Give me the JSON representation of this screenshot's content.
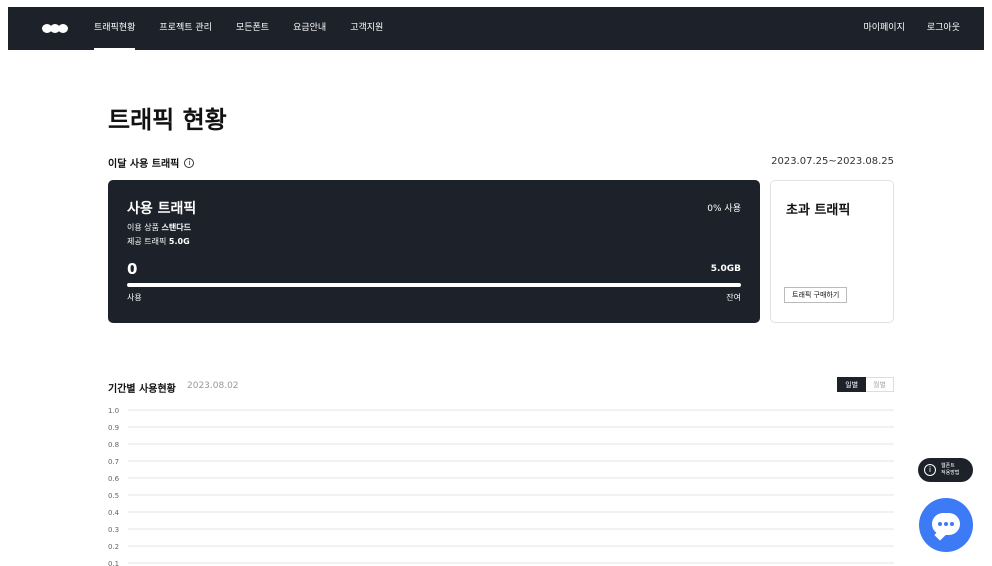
{
  "nav": {
    "items": [
      {
        "label": "트래픽현황",
        "active": true
      },
      {
        "label": "프로젝트 관리",
        "active": false
      },
      {
        "label": "모든폰트",
        "active": false
      },
      {
        "label": "요금안내",
        "active": false
      },
      {
        "label": "고객지원",
        "active": false
      }
    ],
    "mypage_label": "마이페이지",
    "logout_label": "로그아웃"
  },
  "page": {
    "title": "트래픽 현황"
  },
  "monthly": {
    "heading": "이달 사용 트래픽",
    "info_glyph": "i",
    "period": "2023.07.25~2023.08.25"
  },
  "usage_card": {
    "title": "사용 트래픽",
    "percent_text": "0% 사용",
    "plan_prefix": "이용 상품 ",
    "plan_name": "스탠다드",
    "quota_prefix": "제공 트래픽 ",
    "quota_value": "5.0G",
    "used_value": "0",
    "total_value": "5.0GB",
    "used_fraction": 0,
    "left_label": "사용",
    "right_label": "잔여"
  },
  "excess_card": {
    "title": "초과 트래픽",
    "buy_button_label": "트래픽 구매하기"
  },
  "period_usage": {
    "heading": "기간별 사용현황",
    "date": "2023.08.02",
    "toggle_daily": "일별",
    "toggle_monthly": "월별"
  },
  "help": {
    "glyph": "i",
    "line1": "웹폰트",
    "line2": "적용방법"
  },
  "colors": {
    "dark": "#1d2129",
    "accent": "#3d7bf6"
  },
  "chart_data": {
    "type": "line",
    "x": [],
    "series": [],
    "y_ticks": [
      "1.0",
      "0.9",
      "0.8",
      "0.7",
      "0.6",
      "0.5",
      "0.4",
      "0.3",
      "0.2",
      "0.1"
    ],
    "ylim": [
      0,
      1.0
    ],
    "grid": true
  }
}
